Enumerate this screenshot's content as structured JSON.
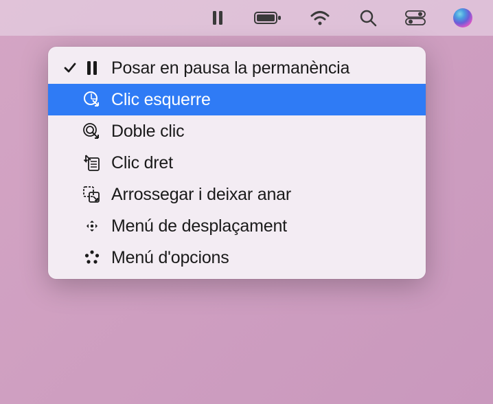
{
  "menubar": {
    "items": [
      {
        "name": "dwell-pause-icon"
      },
      {
        "name": "battery-icon"
      },
      {
        "name": "wifi-icon"
      },
      {
        "name": "search-icon"
      },
      {
        "name": "control-center-icon"
      },
      {
        "name": "siri-icon"
      }
    ]
  },
  "dropdown": {
    "items": [
      {
        "id": "pause-dwell",
        "label": "Posar en pausa la permanència",
        "checked": true,
        "highlighted": false,
        "icon": "pause-icon"
      },
      {
        "id": "left-click",
        "label": "Clic esquerre",
        "checked": false,
        "highlighted": true,
        "icon": "left-click-icon"
      },
      {
        "id": "double-click",
        "label": "Doble clic",
        "checked": false,
        "highlighted": false,
        "icon": "double-click-icon"
      },
      {
        "id": "right-click",
        "label": "Clic dret",
        "checked": false,
        "highlighted": false,
        "icon": "right-click-icon"
      },
      {
        "id": "drag-drop",
        "label": "Arrossegar i deixar anar",
        "checked": false,
        "highlighted": false,
        "icon": "drag-drop-icon"
      },
      {
        "id": "scroll-menu",
        "label": "Menú de desplaçament",
        "checked": false,
        "highlighted": false,
        "icon": "scroll-menu-icon"
      },
      {
        "id": "options-menu",
        "label": "Menú d'opcions",
        "checked": false,
        "highlighted": false,
        "icon": "options-menu-icon"
      }
    ]
  }
}
